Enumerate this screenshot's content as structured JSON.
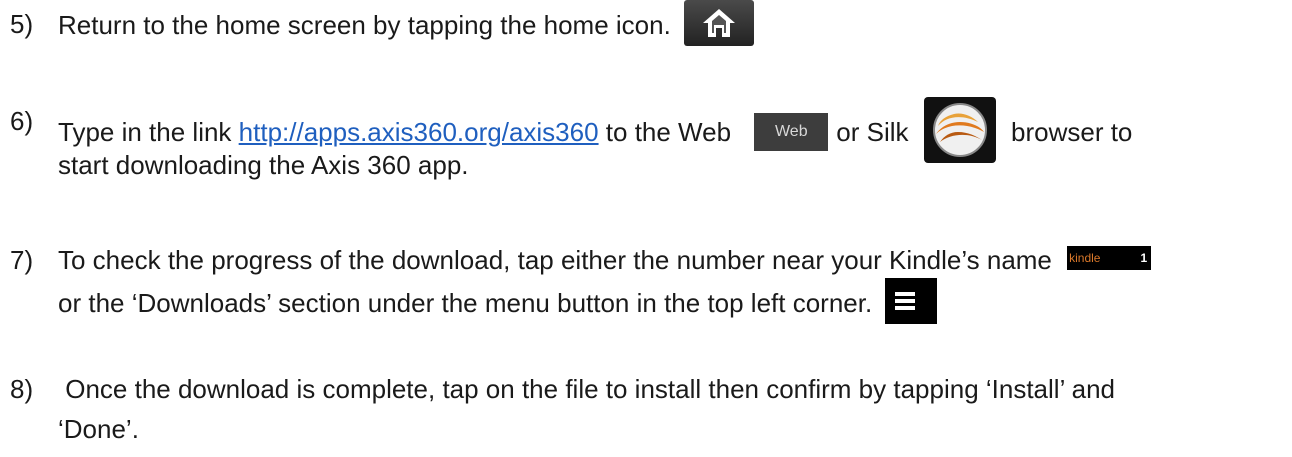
{
  "steps": [
    {
      "number": "5)",
      "text_before": "Return to the home screen by tapping the home icon.",
      "icon": "home-icon"
    },
    {
      "number": "6)",
      "text_before": "Type in the link ",
      "link": "http://apps.axis360.org/axis360",
      "text_mid": " to the Web",
      "web_button_label": "Web",
      "text_or": "or Silk",
      "silk_icon": "silk-browser-icon",
      "text_after": "browser to",
      "text_line2": "start downloading the Axis 360 app."
    },
    {
      "number": "7)",
      "text_line1": "To check the progress of the download, tap either the number near your Kindle’s name",
      "kindle_badge_label": "kindle",
      "kindle_badge_count": "1",
      "text_line2": "or the ‘Downloads’ section under the menu button in the top left corner.",
      "icon": "menu-icon"
    },
    {
      "number": "8)",
      "text_line1": " Once the download is complete, tap on the file to install then confirm by tapping ‘Install’ and",
      "text_line2": "‘Done’."
    }
  ],
  "colors": {
    "text": "#1a1a1a",
    "link": "#1f5fbf",
    "icon_bg": "#222222",
    "kindle_orange": "#d9782a"
  }
}
